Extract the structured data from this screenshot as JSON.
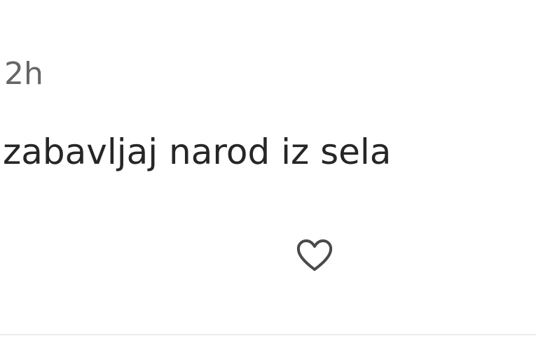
{
  "comment": {
    "timestamp": "2h",
    "text": "zabavljaj narod iz sela",
    "like_icon": "heart-outline-icon",
    "icon_color": "#4a4a4a"
  }
}
